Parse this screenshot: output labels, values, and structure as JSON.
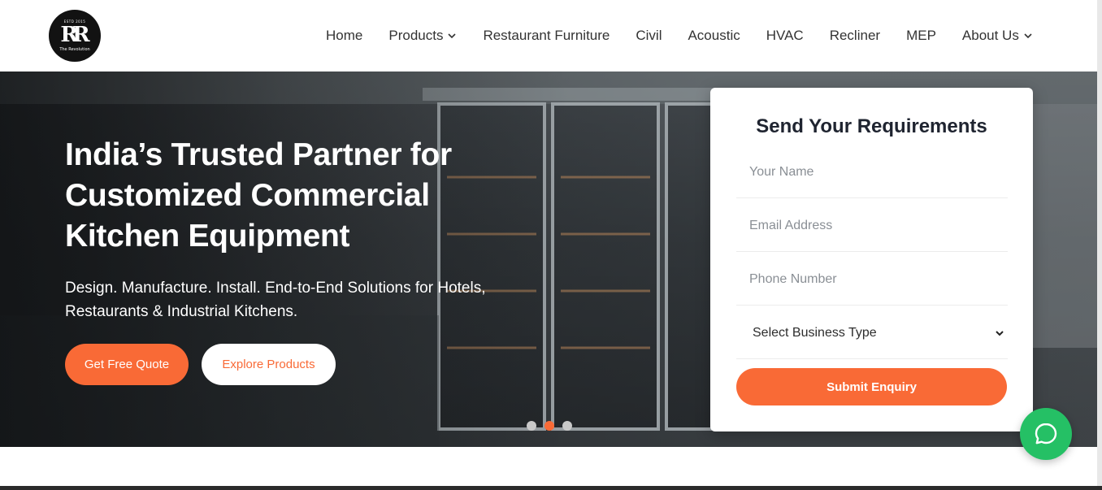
{
  "logo": {
    "top_text": "ESTD 2015",
    "mark": "RR",
    "sub_text": "The Revolution"
  },
  "nav": {
    "items": [
      {
        "label": "Home",
        "dropdown": false
      },
      {
        "label": "Products",
        "dropdown": true
      },
      {
        "label": "Restaurant Furniture",
        "dropdown": false
      },
      {
        "label": "Civil",
        "dropdown": false
      },
      {
        "label": "Acoustic",
        "dropdown": false
      },
      {
        "label": "HVAC",
        "dropdown": false
      },
      {
        "label": "Recliner",
        "dropdown": false
      },
      {
        "label": "MEP",
        "dropdown": false
      },
      {
        "label": "About Us",
        "dropdown": true
      }
    ]
  },
  "hero": {
    "title_line1": "India’s Trusted Partner for",
    "title_line2": "Customized Commercial",
    "title_line3": "Kitchen Equipment",
    "subtitle": "Design. Manufacture. Install. End-to-End Solutions for Hotels, Restaurants & Industrial Kitchens.",
    "cta_primary": "Get Free Quote",
    "cta_secondary": "Explore Products",
    "slider": {
      "count": 3,
      "active_index": 1
    }
  },
  "form": {
    "title": "Send Your Requirements",
    "name_placeholder": "Your Name",
    "email_placeholder": "Email Address",
    "phone_placeholder": "Phone Number",
    "business_type_selected": "Select Business Type",
    "submit_label": "Submit Enquiry"
  },
  "chat_widget": {
    "icon": "whatsapp-icon"
  },
  "colors": {
    "accent": "#f96a36",
    "whatsapp": "#25c065",
    "heading": "#1f2430",
    "nav_text": "#333333"
  }
}
